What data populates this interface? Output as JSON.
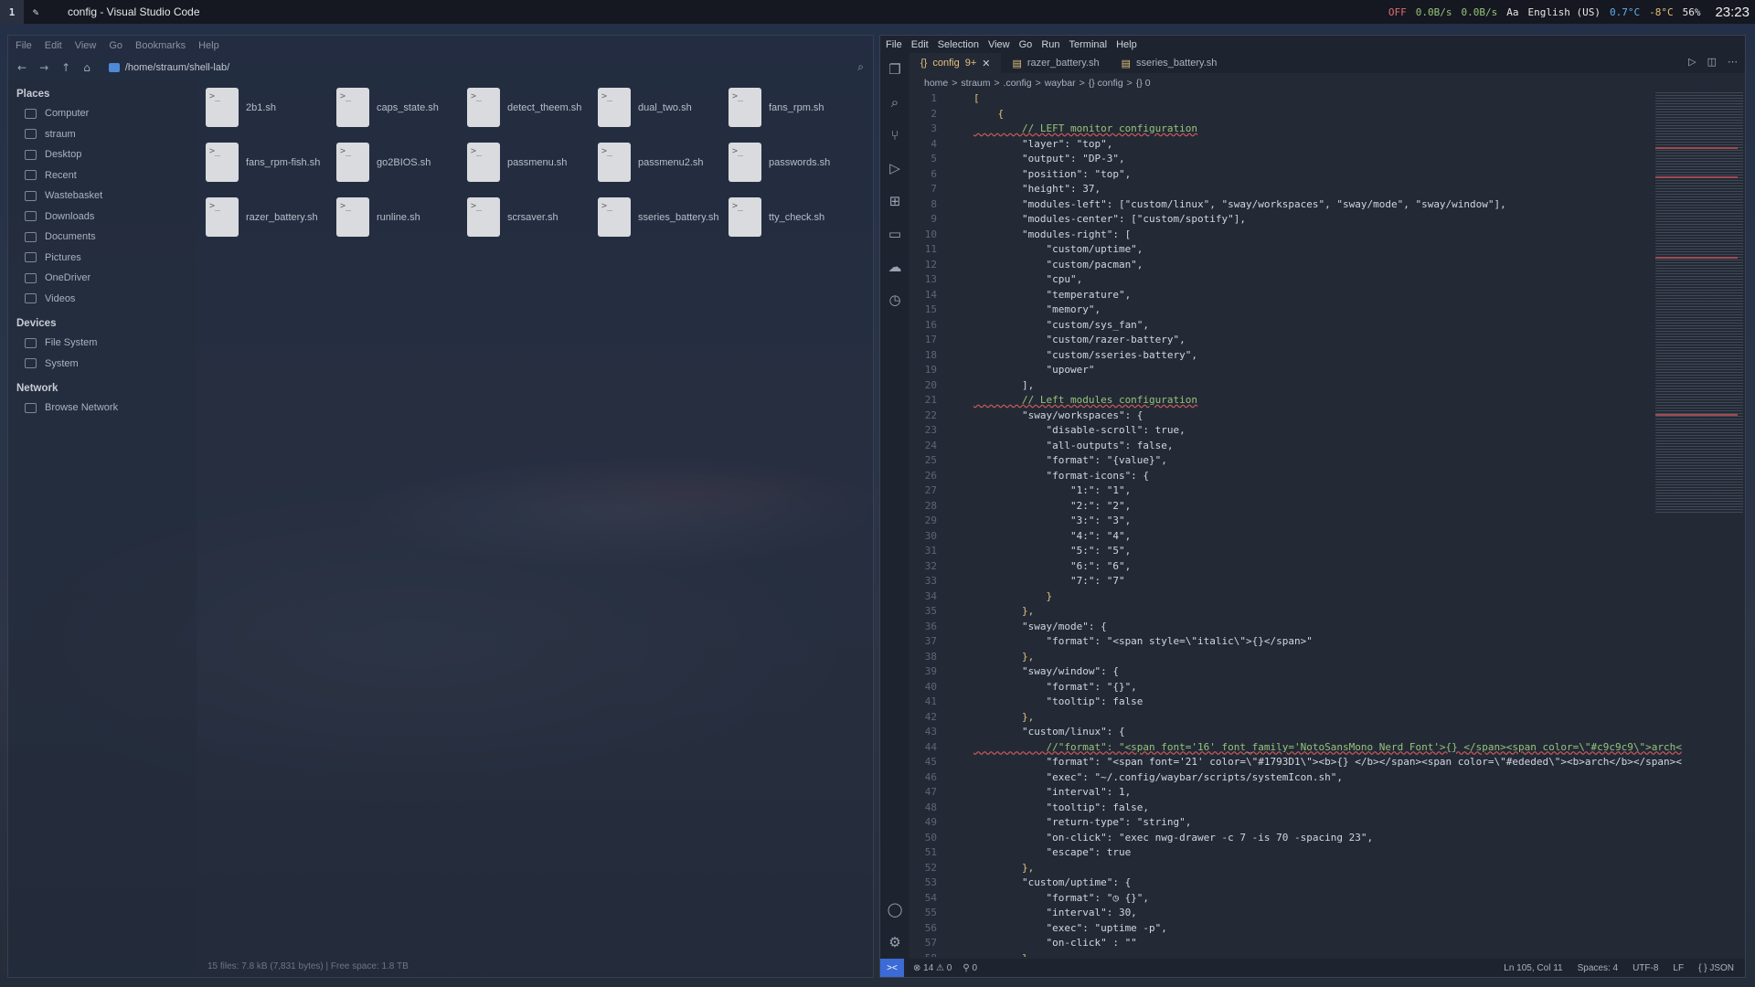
{
  "topbar": {
    "workspace": "1",
    "window_title": "config - Visual Studio Code",
    "status": [
      "OFF",
      "0.0B/s",
      "0.0B/s",
      "Aa",
      "English (US)",
      "0.7°C",
      "-8°C",
      "56%"
    ],
    "clock": "23:23"
  },
  "filemanager": {
    "menu": [
      "File",
      "Edit",
      "View",
      "Go",
      "Bookmarks",
      "Help"
    ],
    "path": "/home/straum/shell-lab/",
    "places_header": "Places",
    "places": [
      "Computer",
      "straum",
      "Desktop",
      "Recent",
      "Wastebasket",
      "Downloads",
      "Documents",
      "Pictures",
      "OneDriver",
      "Videos"
    ],
    "devices_header": "Devices",
    "devices": [
      "File System",
      "System"
    ],
    "network_header": "Network",
    "network": [
      "Browse Network"
    ],
    "files": [
      "2b1.sh",
      "caps_state.sh",
      "detect_theem.sh",
      "dual_two.sh",
      "fans_rpm.sh",
      "fans_rpm-fish.sh",
      "go2BIOS.sh",
      "passmenu.sh",
      "passmenu2.sh",
      "passwords.sh",
      "razer_battery.sh",
      "runline.sh",
      "scrsaver.sh",
      "sseries_battery.sh",
      "tty_check.sh"
    ],
    "file_glyph": ">_",
    "status": "15 files: 7.8 kB (7,831 bytes)  |  Free space: 1.8 TB"
  },
  "vscode": {
    "menu": [
      "File",
      "Edit",
      "Selection",
      "View",
      "Go",
      "Run",
      "Terminal",
      "Help"
    ],
    "tabs": [
      {
        "label": "config",
        "badge": "9+",
        "active": true
      },
      {
        "label": "razer_battery.sh",
        "active": false
      },
      {
        "label": "sseries_battery.sh",
        "active": false
      }
    ],
    "breadcrumbs": [
      "home",
      ">",
      "straum",
      ">",
      ".config",
      ">",
      "waybar",
      ">",
      "{} config",
      ">",
      "{} 0"
    ],
    "code": [
      "[",
      "    {",
      "        // LEFT monitor configuration",
      "        \"layer\": \"top\",",
      "        \"output\": \"DP-3\",",
      "        \"position\": \"top\",",
      "        \"height\": 37,",
      "        \"modules-left\": [\"custom/linux\", \"sway/workspaces\", \"sway/mode\", \"sway/window\"],",
      "        \"modules-center\": [\"custom/spotify\"],",
      "        \"modules-right\": [",
      "            \"custom/uptime\",",
      "            \"custom/pacman\",",
      "            \"cpu\",",
      "            \"temperature\",",
      "            \"memory\",",
      "            \"custom/sys_fan\",",
      "            \"custom/razer-battery\",",
      "            \"custom/sseries-battery\",",
      "            \"upower\"",
      "        ],",
      "        // Left modules configuration",
      "        \"sway/workspaces\": {",
      "            \"disable-scroll\": true,",
      "            \"all-outputs\": false,",
      "            \"format\": \"{value}\",",
      "            \"format-icons\": {",
      "                \"1:\": \"1\",",
      "                \"2:\": \"2\",",
      "                \"3:\": \"3\",",
      "                \"4:\": \"4\",",
      "                \"5:\": \"5\",",
      "                \"6:\": \"6\",",
      "                \"7:\": \"7\"",
      "            }",
      "        },",
      "        \"sway/mode\": {",
      "            \"format\": \"<span style=\\\"italic\\\">{}</span>\"",
      "        },",
      "        \"sway/window\": {",
      "            \"format\": \"{}\",",
      "            \"tooltip\": false",
      "        },",
      "        \"custom/linux\": {",
      "            //\"format\": \"<span font='16' font_family='NotoSansMono Nerd Font'>{} </span><span color=\\\"#c9c9c9\\\">arch<",
      "            \"format\": \"<span font='21' color=\\\"#1793D1\\\"><b>{} </b></span><span color=\\\"#ededed\\\"><b>arch</b></span><",
      "            \"exec\": \"~/.config/waybar/scripts/systemIcon.sh\",",
      "            \"interval\": 1,",
      "            \"tooltip\": false,",
      "            \"return-type\": \"string\",",
      "            \"on-click\": \"exec nwg-drawer -c 7 -is 70 -spacing 23\",",
      "            \"escape\": true",
      "        },",
      "        \"custom/uptime\": {",
      "            \"format\": \"◷ {}\",",
      "            \"interval\": 30,",
      "            \"exec\": \"uptime -p\",",
      "            \"on-click\" : \"\"",
      "        },"
    ],
    "statusbar": {
      "remote": "><",
      "problems": "⊗ 14 ⚠ 0",
      "ports": "⚲ 0",
      "position": "Ln 105, Col 11",
      "spaces": "Spaces: 4",
      "encoding": "UTF-8",
      "eol": "LF",
      "language": "{ } JSON"
    }
  }
}
